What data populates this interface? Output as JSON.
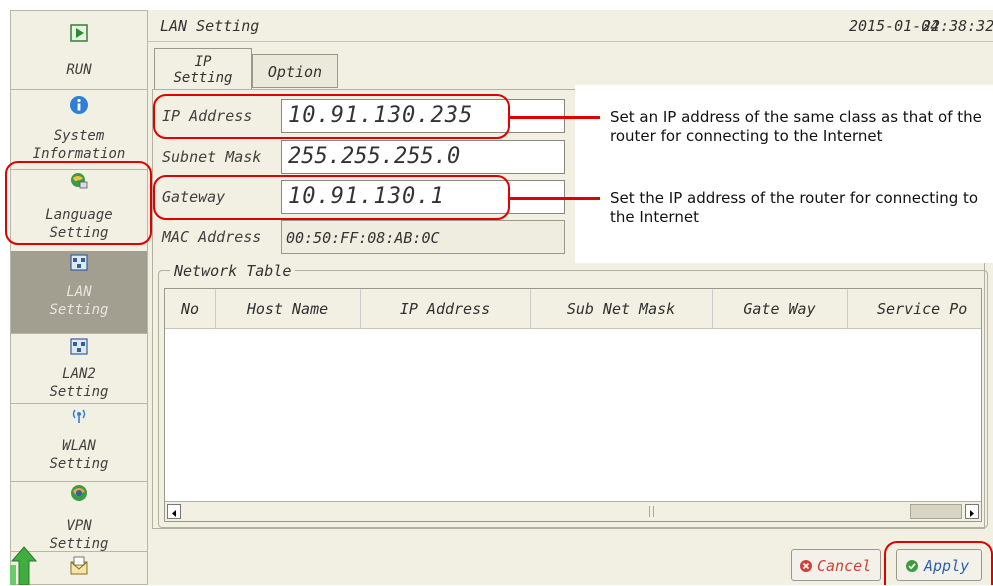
{
  "sidebar": {
    "items": [
      {
        "label": "RUN",
        "icon": "play-icon",
        "active": false
      },
      {
        "label": "System\nInformation",
        "icon": "info-icon",
        "active": false
      },
      {
        "label": "Language\nSetting",
        "icon": "language-icon",
        "active": false
      },
      {
        "label": "LAN\nSetting",
        "icon": "network-icon",
        "active": true
      },
      {
        "label": "LAN2\nSetting",
        "icon": "network-icon",
        "active": false
      },
      {
        "label": "WLAN\nSetting",
        "icon": "wireless-icon",
        "active": false
      },
      {
        "label": "VPN\nSetting",
        "icon": "vpn-icon",
        "active": false
      }
    ]
  },
  "header": {
    "title": "LAN Setting",
    "date": "2015-01-04",
    "time": "22:38:32"
  },
  "tabs": [
    {
      "label": "IP\nSetting"
    },
    {
      "label": "Option"
    }
  ],
  "form": {
    "ip_label": "IP Address",
    "ip_value": "10.91.130.235",
    "subnet_label": "Subnet Mask",
    "subnet_value": "255.255.255.0",
    "gateway_label": "Gateway",
    "gateway_value": "10.91.130.1",
    "mac_label": "MAC Address",
    "mac_value": "00:50:FF:08:AB:0C"
  },
  "network_table": {
    "legend": "Network Table",
    "columns": [
      "No",
      "Host Name",
      "IP Address",
      "Sub Net Mask",
      "Gate Way",
      "Service Po"
    ]
  },
  "buttons": {
    "cancel": "Cancel",
    "apply": "Apply"
  },
  "annotations": {
    "ip": "Set an IP address of the same class as that of the router for connecting to the Internet",
    "gateway": "Set the IP address of the router for connecting to the Internet"
  },
  "colors": {
    "highlight": "#e10000",
    "panel": "#f2f0e2",
    "active_item": "#a29f90"
  }
}
